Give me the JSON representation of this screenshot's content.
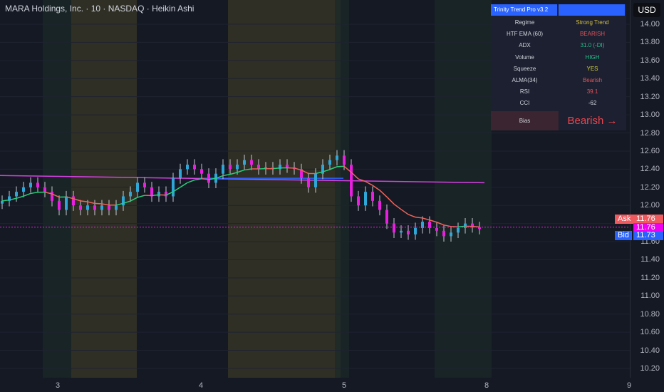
{
  "header": {
    "title": "MARA Holdings, Inc. · 10 · NASDAQ · Heikin Ashi",
    "currency": "USD"
  },
  "price_axis": [
    "14.00",
    "13.80",
    "13.60",
    "13.40",
    "13.20",
    "13.00",
    "12.80",
    "12.60",
    "12.40",
    "12.20",
    "12.00",
    "11.80",
    "11.60",
    "11.40",
    "11.20",
    "11.00",
    "10.80",
    "10.60",
    "10.40",
    "10.20"
  ],
  "time_axis": [
    "3",
    "4",
    "5",
    "8",
    "9"
  ],
  "quotes": {
    "ask_label": "Ask",
    "ask": "11.76",
    "last": "11.76",
    "bid_label": "Bid",
    "bid": "11.73"
  },
  "table": {
    "title": "Trinity Trend Pro v3.2",
    "rows": [
      {
        "label": "Regime",
        "value": "Strong Trend",
        "color": "#d4c040"
      },
      {
        "label": "HTF EMA (60)",
        "value": "BEARISH",
        "color": "#e0535a"
      },
      {
        "label": "ADX",
        "value": "31.0 (-DI)",
        "color": "#26c08a"
      },
      {
        "label": "Volume",
        "value": "HIGH",
        "color": "#26c08a"
      },
      {
        "label": "Squeeze",
        "value": "YES",
        "color": "#d4d040"
      },
      {
        "label": "ALMA(34)",
        "value": "Bearish",
        "color": "#e0535a"
      },
      {
        "label": "RSI",
        "value": "39.1",
        "color": "#e0535a"
      },
      {
        "label": "CCI",
        "value": "-62",
        "color": "#d1d4dc"
      }
    ],
    "bias_label": "Bias",
    "bias_value": "Bearish →"
  },
  "colors": {
    "up": "#2ea6d8",
    "down": "#e91ee0",
    "sma": "#d442e0",
    "htf": "#2962ff",
    "ema_up": "#26d07a",
    "ema_down": "#f0645a"
  },
  "chart_data": {
    "type": "candlestick",
    "closes": [
      12.05,
      12.1,
      12.15,
      12.2,
      12.25,
      12.2,
      12.15,
      12.05,
      11.95,
      12.1,
      12.0,
      11.95,
      12.0,
      11.95,
      12.0,
      11.95,
      12.0,
      12.1,
      12.15,
      12.25,
      12.2,
      12.1,
      12.15,
      12.1,
      12.3,
      12.4,
      12.45,
      12.4,
      12.35,
      12.25,
      12.35,
      12.45,
      12.4,
      12.45,
      12.5,
      12.45,
      12.4,
      12.42,
      12.4,
      12.45,
      12.42,
      12.4,
      12.3,
      12.2,
      12.35,
      12.45,
      12.5,
      12.55,
      12.45,
      12.1,
      12.0,
      12.15,
      12.05,
      11.95,
      11.8,
      11.7,
      11.72,
      11.68,
      11.75,
      11.82,
      11.75,
      11.72,
      11.66,
      11.7,
      11.75,
      11.8,
      11.76,
      11.74
    ],
    "sma_start": 12.33,
    "sma_end": 12.25,
    "htf_level": 12.3,
    "ylim": [
      10.2,
      14.0
    ]
  }
}
